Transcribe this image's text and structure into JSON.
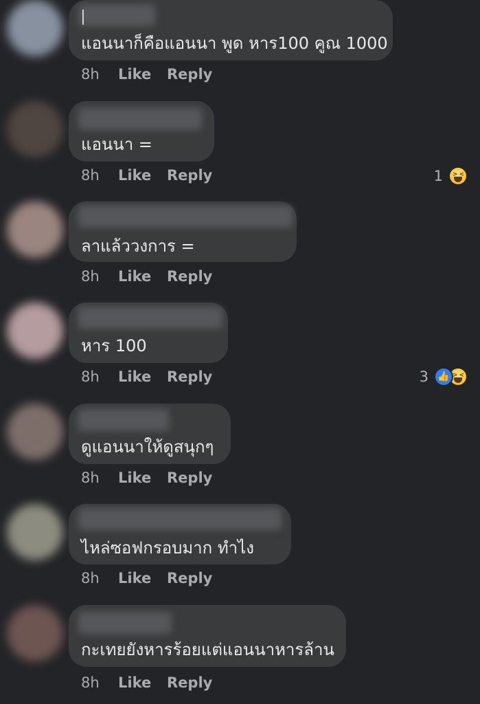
{
  "comments": [
    {
      "text": "แอนนาก็คือแอนนา พูด หาร100 คูณ 1000",
      "time": "8h",
      "like_label": "Like",
      "reply_label": "Reply",
      "reaction_count": "",
      "reaction_icons": [],
      "avatar_color": "#8791a0"
    },
    {
      "text": "แอนนา =",
      "time": "8h",
      "like_label": "Like",
      "reply_label": "Reply",
      "reaction_count": "1",
      "reaction_icons": [
        "haha-icon"
      ],
      "avatar_color": "#4f4641"
    },
    {
      "text": "ลาแล้ววงการ =",
      "time": "8h",
      "like_label": "Like",
      "reply_label": "Reply",
      "reaction_count": "",
      "reaction_icons": [],
      "avatar_color": "#9b8580"
    },
    {
      "text": "หาร 100",
      "time": "8h",
      "like_label": "Like",
      "reply_label": "Reply",
      "reaction_count": "3",
      "reaction_icons": [
        "like-icon",
        "haha-icon"
      ],
      "avatar_color": "#b59c9e"
    },
    {
      "text": "ดูแอนนาให้ดูสนุกๆ",
      "time": "8h",
      "like_label": "Like",
      "reply_label": "Reply",
      "reaction_count": "",
      "reaction_icons": [],
      "avatar_color": "#7d6e6a"
    },
    {
      "text": "ไหล่ซอฟกรอบมาก ทำไง",
      "time": "8h",
      "like_label": "Like",
      "reply_label": "Reply",
      "reaction_count": "",
      "reaction_icons": [],
      "avatar_color": "#8c8c80"
    },
    {
      "text": "กะเทยยังหารร้อยแต่แอนนาหารล้าน",
      "time": "8h",
      "like_label": "Like",
      "reply_label": "Reply",
      "reaction_count": "",
      "reaction_icons": [],
      "avatar_color": "#6d5552"
    }
  ],
  "colors": {
    "background": "#232427",
    "bubble": "#3a3b3c",
    "meta_text": "#a9abae",
    "like_reaction": "#2d7ef0",
    "haha_reaction": "#f7c843"
  }
}
